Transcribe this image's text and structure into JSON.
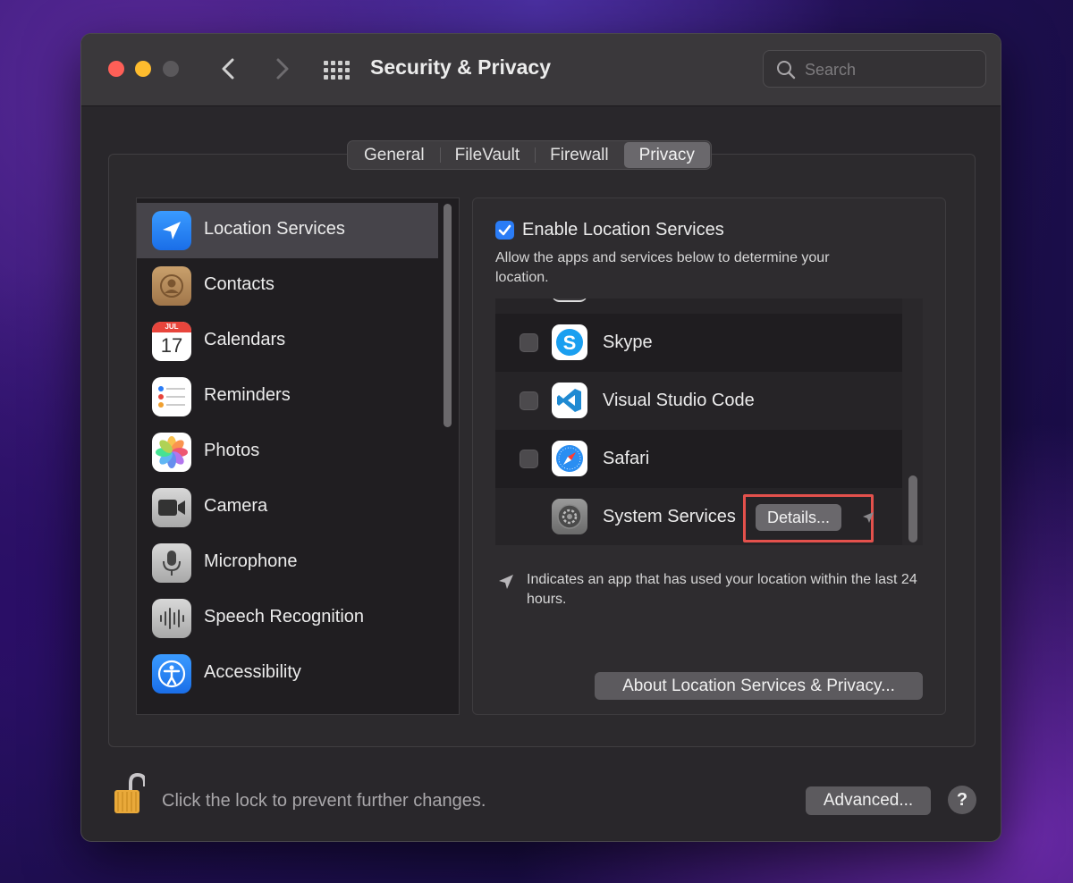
{
  "window": {
    "title": "Security & Privacy",
    "search_placeholder": "Search"
  },
  "tabs": [
    {
      "label": "General",
      "active": false
    },
    {
      "label": "FileVault",
      "active": false
    },
    {
      "label": "Firewall",
      "active": false
    },
    {
      "label": "Privacy",
      "active": true
    }
  ],
  "sidebar": {
    "items": [
      {
        "label": "Location Services",
        "icon": "location-arrow-icon",
        "selected": true
      },
      {
        "label": "Contacts",
        "icon": "contacts-icon"
      },
      {
        "label": "Calendars",
        "icon": "calendar-icon",
        "icon_text_month": "JUL",
        "icon_text_day": "17"
      },
      {
        "label": "Reminders",
        "icon": "reminders-icon"
      },
      {
        "label": "Photos",
        "icon": "photos-icon"
      },
      {
        "label": "Camera",
        "icon": "camera-icon"
      },
      {
        "label": "Microphone",
        "icon": "microphone-icon"
      },
      {
        "label": "Speech Recognition",
        "icon": "speech-recognition-icon"
      },
      {
        "label": "Accessibility",
        "icon": "accessibility-icon"
      }
    ]
  },
  "location": {
    "enable_label": "Enable Location Services",
    "enabled": true,
    "description": "Allow the apps and services below to determine your location.",
    "apps": [
      {
        "name": "Skype",
        "checked": false,
        "icon": "skype-icon"
      },
      {
        "name": "Visual Studio Code",
        "checked": false,
        "icon": "vscode-icon"
      },
      {
        "name": "Safari",
        "checked": false,
        "icon": "safari-icon"
      },
      {
        "name": "System Services",
        "icon": "system-preferences-icon",
        "button": "Details..."
      }
    ],
    "indicator_text": "Indicates an app that has used your location within the last 24 hours.",
    "about_button": "About Location Services & Privacy..."
  },
  "footer": {
    "lock_text": "Click the lock to prevent further changes.",
    "advanced_button": "Advanced...",
    "help_button": "?"
  },
  "colors": {
    "accent": "#2a7cf6",
    "highlight": "#e4514c",
    "close": "#fe5f57",
    "minimize": "#febc2e"
  }
}
